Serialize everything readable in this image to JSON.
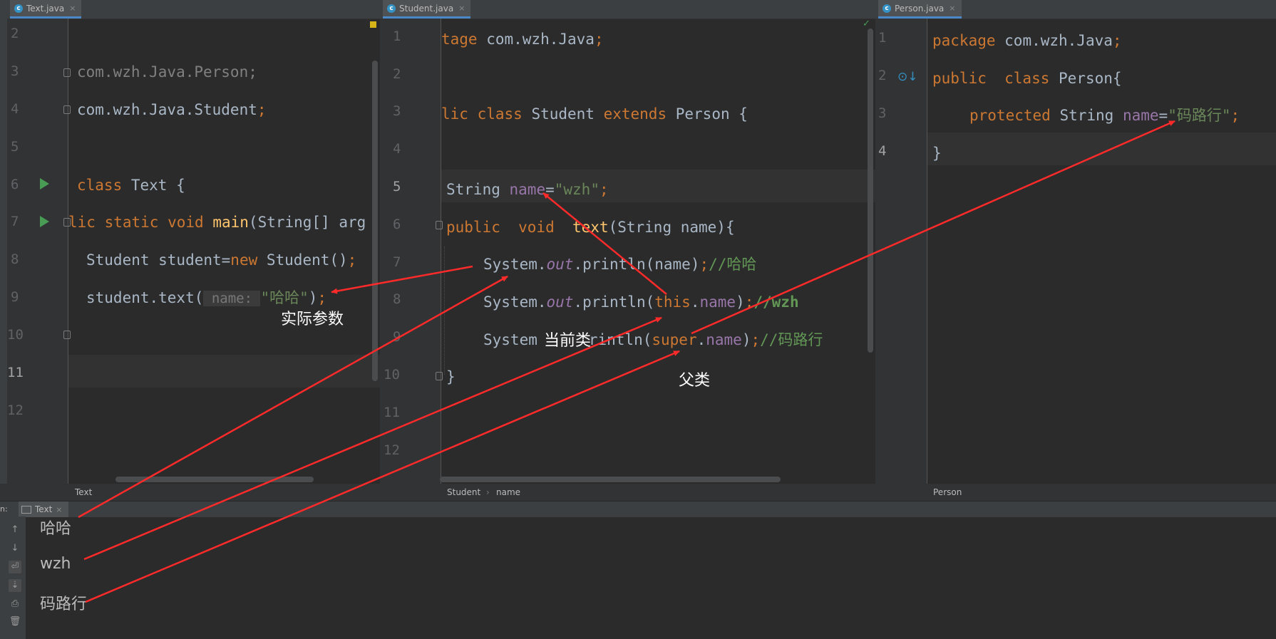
{
  "tabs": {
    "text": "Text.java",
    "student": "Student.java",
    "person": "Person.java"
  },
  "text_editor": {
    "line_numbers": [
      "2",
      "3",
      "4",
      "5",
      "6",
      "7",
      "8",
      "9",
      "10",
      "11",
      "12"
    ],
    "lines": {
      "l3_text": "com.wzh.Java.Person;",
      "l4_text": "com.wzh.Java.Student",
      "l4_semi": ";",
      "l6_kw": "class",
      "l6_rest": " Text {",
      "l7_kw1": "lic",
      "l7_kw2": "static",
      "l7_kw3": "void",
      "l7_fn": "main",
      "l7_rest": "(String[] arg",
      "l8_a": "Student student=",
      "l8_new": "new",
      "l8_b": " Student()",
      "l8_semi": ";",
      "l9_a": "student.text(",
      "l9_hint": " name: ",
      "l9_str": "\"哈哈\"",
      "l9_b": ")",
      "l9_semi": ";"
    }
  },
  "student_editor": {
    "line_numbers": [
      "1",
      "2",
      "3",
      "4",
      "5",
      "6",
      "7",
      "8",
      "9",
      "10",
      "11",
      "12"
    ],
    "lines": {
      "l1_kw": "tage",
      "l1_rest": " com.wzh.Java",
      "l1_semi": ";",
      "l3_kw1": "lic class",
      "l3_mid": " Student ",
      "l3_kw2": "extends",
      "l3_rest": " Person {",
      "l5_a": "String ",
      "l5_fld": "name",
      "l5_eq": "=",
      "l5_str": "\"wzh\"",
      "l5_semi": ";",
      "l6_kw": "public  void",
      "l6_fn": "text",
      "l6_rest": "(String name){",
      "l7_a": "System.",
      "l7_out": "out",
      "l7_b": ".println(name)",
      "l7_semi": ";",
      "l7_cmt": "//哈哈",
      "l8_a": "System.",
      "l8_out": "out",
      "l8_b": ".println(",
      "l8_this": "this",
      "l8_dot": ".",
      "l8_fld": "name",
      "l8_c": ")",
      "l8_semi": ";",
      "l8_cmt": "//wzh",
      "l9_a": "System",
      "l9_b": "rintln(",
      "l9_super": "super",
      "l9_dot": ".",
      "l9_fld": "name",
      "l9_c": ")",
      "l9_semi": ";",
      "l9_cmt": "//码路行",
      "l10": "}"
    }
  },
  "person_editor": {
    "line_numbers": [
      "1",
      "2",
      "3",
      "4"
    ],
    "lines": {
      "l1_kw": "package",
      "l1_rest": " com.wzh.Java",
      "l1_semi": ";",
      "l2_kw": "public  class",
      "l2_rest": " Person{",
      "l3_kw": "protected",
      "l3_a": " String ",
      "l3_fld": "name",
      "l3_eq": "=",
      "l3_str": "\"码路行\"",
      "l3_semi": ";",
      "l4": "}"
    }
  },
  "breadcrumbs": {
    "text": "Text",
    "student": "Student",
    "student_member": "name",
    "person": "Person"
  },
  "run_panel": {
    "label": "n:",
    "tab": "Text",
    "output": [
      "哈哈",
      "wzh",
      "码路行"
    ]
  },
  "annotations": {
    "actual_param": "实际参数",
    "current_class": "当前类",
    "parent_class": "父类"
  },
  "colors": {
    "arrow": "#ff2a2a",
    "keyword": "#cc7832",
    "string": "#6a8759",
    "field": "#9876aa"
  }
}
